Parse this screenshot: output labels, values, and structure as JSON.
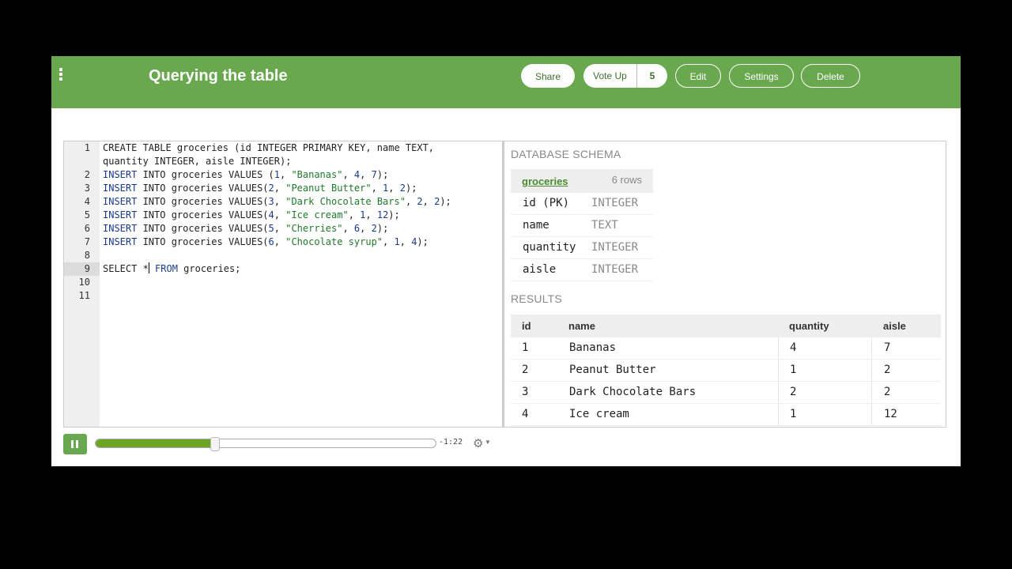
{
  "header": {
    "title": "Querying the table",
    "share_label": "Share",
    "vote_label": "Vote Up",
    "vote_count": "5",
    "edit_label": "Edit",
    "settings_label": "Settings",
    "delete_label": "Delete"
  },
  "editor": {
    "line_numbers": [
      "1",
      "2",
      "3",
      "4",
      "5",
      "6",
      "7",
      "8",
      "9",
      "10",
      "11"
    ],
    "code": {
      "l1a": "CREATE TABLE groceries (id INTEGER PRIMARY KEY, name TEXT,",
      "l1b": "quantity INTEGER, aisle INTEGER);",
      "insert_kw": "INSERT",
      "l2_rest_a": " INTO groceries VALUES (",
      "l2_n1": "1",
      "l2_s": "\"Bananas\"",
      "l2_n2": "4",
      "l2_n3": "7",
      "l3_rest_a": " INTO groceries VALUES(",
      "l3_n1": "2",
      "l3_s": "\"Peanut Butter\"",
      "l3_n2": "1",
      "l3_n3": "2",
      "l4_n1": "3",
      "l4_s": "\"Dark Chocolate Bars\"",
      "l4_n2": "2",
      "l4_n3": "2",
      "l5_n1": "4",
      "l5_s": "\"Ice cream\"",
      "l5_n2": "1",
      "l5_n3": "12",
      "l6_n1": "5",
      "l6_s": "\"Cherries\"",
      "l6_n2": "6",
      "l6_n3": "2",
      "l7_n1": "6",
      "l7_s": "\"Chocolate syrup\"",
      "l7_n2": "1",
      "l7_n3": "4",
      "l9_a": "SELECT *",
      "l9_kw": "FROM",
      "l9_b": " groceries;"
    }
  },
  "schema": {
    "section_label": "DATABASE SCHEMA",
    "table_name": "groceries",
    "row_count": "6 rows",
    "columns": [
      {
        "name": "id (PK)",
        "type": "INTEGER"
      },
      {
        "name": "name",
        "type": "TEXT"
      },
      {
        "name": "quantity",
        "type": "INTEGER"
      },
      {
        "name": "aisle",
        "type": "INTEGER"
      }
    ]
  },
  "results": {
    "section_label": "RESULTS",
    "headers": [
      "id",
      "name",
      "quantity",
      "aisle"
    ],
    "rows": [
      [
        "1",
        "Bananas",
        "4",
        "7"
      ],
      [
        "2",
        "Peanut Butter",
        "1",
        "2"
      ],
      [
        "3",
        "Dark Chocolate Bars",
        "2",
        "2"
      ],
      [
        "4",
        "Ice cream",
        "1",
        "12"
      ]
    ]
  },
  "player": {
    "time_remaining": "-1:22",
    "progress_fraction": 0.35
  },
  "colors": {
    "brand_green": "#69a84f",
    "progress_green": "#6ea424"
  }
}
